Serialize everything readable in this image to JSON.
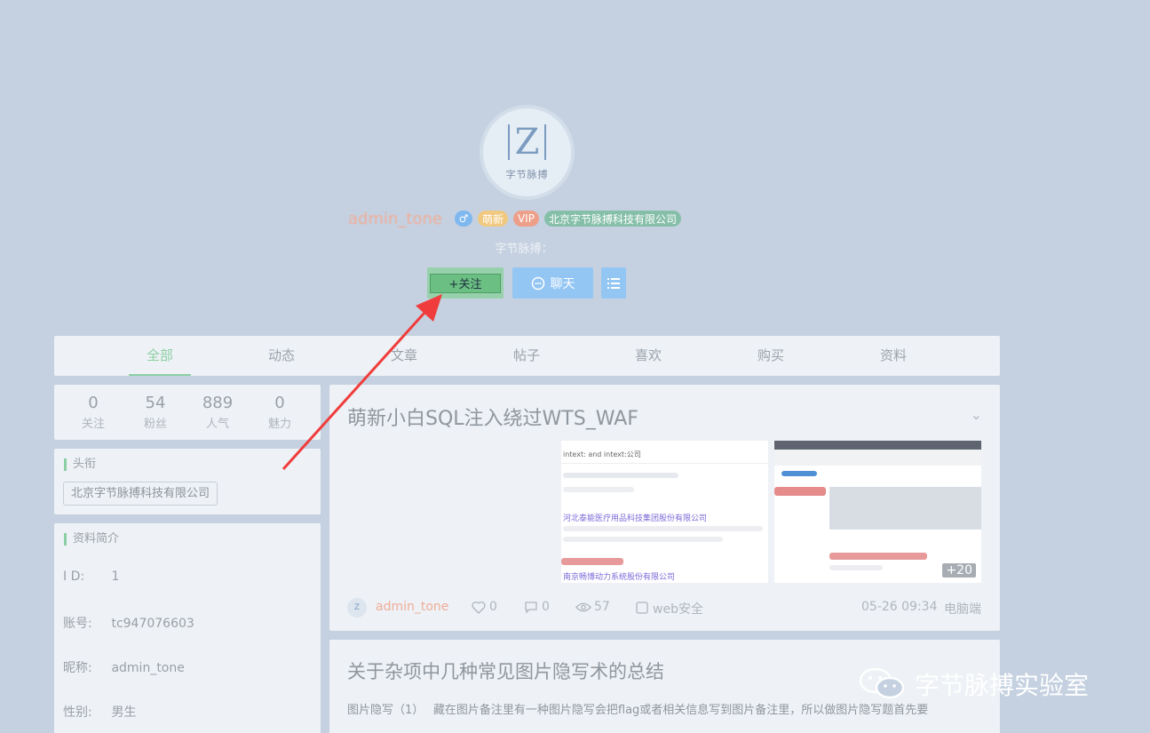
{
  "profile": {
    "avatar_caption": "字节脉搏",
    "avatar_letter": "Z",
    "username": "admin_tone",
    "badges": {
      "gender": "♂",
      "new": "萌新",
      "vip": "VIP",
      "company": "北京字节脉搏科技有限公司"
    },
    "motto": "字节脉搏：",
    "follow_label": "+关注",
    "chat_label": "聊天"
  },
  "tabs": [
    "全部",
    "动态",
    "文章",
    "帖子",
    "喜欢",
    "购买",
    "资料"
  ],
  "stats": [
    {
      "value": "0",
      "label": "关注"
    },
    {
      "value": "54",
      "label": "粉丝"
    },
    {
      "value": "889",
      "label": "人气"
    },
    {
      "value": "0",
      "label": "魅力"
    }
  ],
  "title_card": {
    "heading": "头衔",
    "tag": "北京字节脉搏科技有限公司"
  },
  "info_card": {
    "heading": "资料简介",
    "rows": [
      {
        "key": "I  D:",
        "value": "1"
      },
      {
        "key": "账号:",
        "value": "tc947076603"
      },
      {
        "key": "昵称:",
        "value": "admin_tone"
      },
      {
        "key": "性别:",
        "value": "男生"
      }
    ]
  },
  "posts": [
    {
      "title": "萌新小白SQL注入绕过WTS_WAF",
      "more_images": "+20",
      "author": "admin_tone",
      "likes": "0",
      "comments": "0",
      "views": "57",
      "category": "web安全",
      "time": "05-26 09:34",
      "device": "电脑端",
      "thumb1_search": "intext: and intext:公司",
      "thumb1_result1": "河北泰能医疗用品科技集团股份有限公司",
      "thumb1_result2": "南京畅博动力系统股份有限公司"
    },
    {
      "title": "关于杂项中几种常见图片隐写术的总结",
      "excerpt": "图片隐写（1）　 藏在图片备注里有一种图片隐写会把flag或者相关信息写到图片备注里，所以做图片隐写题首先要"
    }
  ],
  "watermark": "字节脉搏实验室",
  "colors": {
    "accent_green": "#8bd0a4",
    "accent_blue": "#93c6f3",
    "username": "#f0ad9a",
    "arrow_red": "#f03c3c"
  }
}
